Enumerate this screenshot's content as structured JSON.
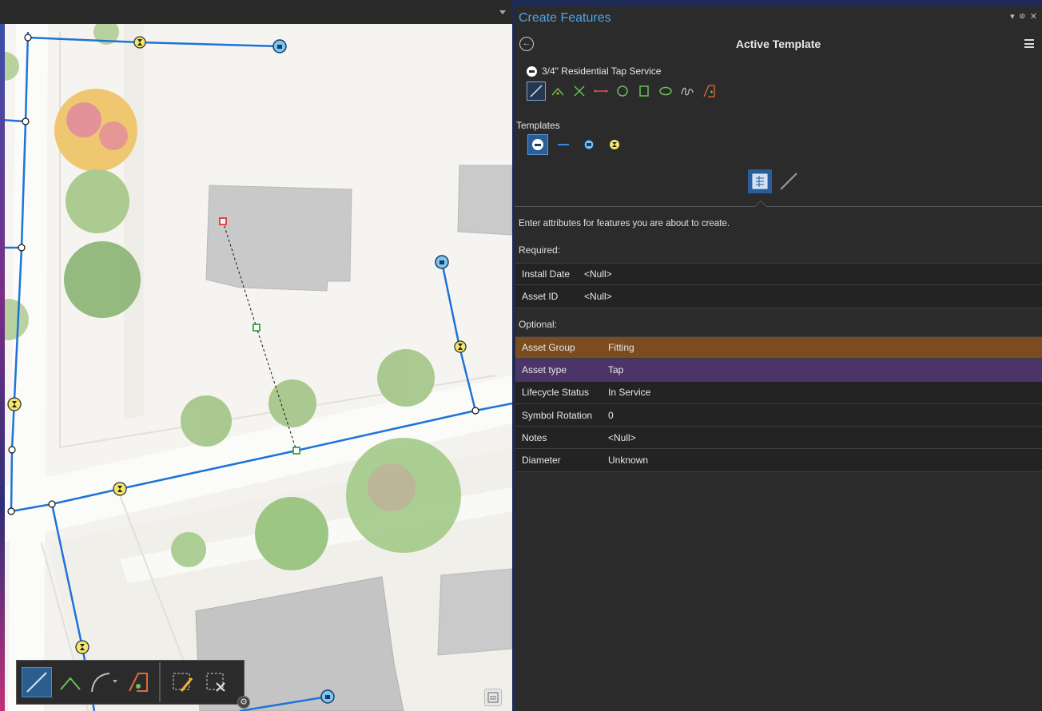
{
  "panel": {
    "title": "Create Features",
    "controls": {
      "menu": "▾",
      "pin": "ⱷ",
      "close": "✕"
    },
    "header": "Active Template",
    "template_name": "3/4\" Residential Tap Service",
    "templates_label": "Templates",
    "instructions": "Enter attributes for features you are about to create.",
    "required_label": "Required:",
    "optional_label": "Optional:",
    "required_attributes": [
      {
        "field": "Install Date",
        "value": "<Null>"
      },
      {
        "field": "Asset ID",
        "value": "<Null>"
      }
    ],
    "optional_attributes": [
      {
        "field": "Asset Group",
        "value": "Fitting"
      },
      {
        "field": "Asset type",
        "value": "Tap"
      },
      {
        "field": "Lifecycle Status",
        "value": "In Service"
      },
      {
        "field": "Symbol Rotation",
        "value": "0"
      },
      {
        "field": "Notes",
        "value": "<Null>"
      },
      {
        "field": "Diameter",
        "value": "Unknown"
      }
    ],
    "construction_tools": [
      "line-icon",
      "right-angle-line-icon",
      "midpoint-icon",
      "distance-direction-icon",
      "circle-icon",
      "rectangle-icon",
      "ellipse-icon",
      "freehand-icon",
      "trace-icon"
    ],
    "template_items": [
      "tap-service-icon",
      "line-feature-icon",
      "service-point-icon",
      "valve-icon"
    ]
  },
  "colors": {
    "accent": "#4ea6e8",
    "asset_group_row": "#7b4c1f",
    "asset_type_row": "#4b3568",
    "map_line": "#1e73d8"
  },
  "map_toolbar": {
    "tools": [
      "line-tool-icon",
      "right-angle-tool-icon",
      "arc-tool-icon",
      "trace-tool-icon",
      "edit-vertices-icon",
      "discard-icon"
    ]
  }
}
